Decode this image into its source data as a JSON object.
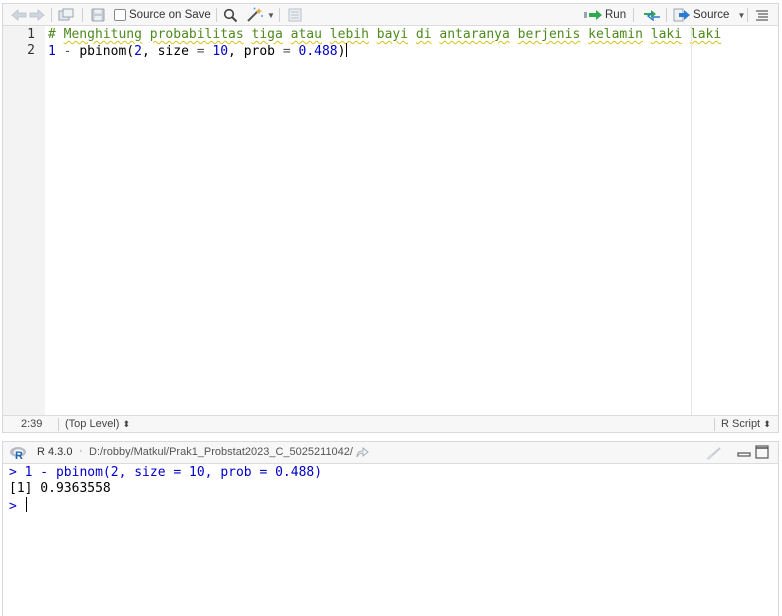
{
  "editor": {
    "toolbar": {
      "source_on_save_label": "Source on Save",
      "source_on_save_checked": false,
      "run_label": "Run",
      "source_label": "Source"
    },
    "lines": [
      {
        "number": "1",
        "text": "# Menghitung probabilitas tiga atau lebih bayi di antaranya berjenis kelamin laki laki"
      },
      {
        "number": "2",
        "text": "1 - pbinom(2, size = 10, prob = 0.488)"
      }
    ],
    "status": {
      "cursor_position": "2:39",
      "scope": "(Top Level)",
      "file_type": "R Script"
    }
  },
  "console": {
    "r_version": "R 4.3.0",
    "working_dir": "D:/robby/Matkul/Prak1_Probstat2023_C_5025211042/",
    "lines": [
      {
        "prompt": ">",
        "text": "1 - pbinom(2, size = 10, prob = 0.488)"
      },
      {
        "text": "[1] 0.9363558"
      },
      {
        "prompt": ">",
        "text": ""
      }
    ]
  },
  "colors": {
    "comment": "#4d8a1c",
    "number": "#0000c8",
    "console_input": "#0000c8",
    "run_arrow": "#2fa84f"
  },
  "icons": [
    "back-arrow-icon",
    "forward-arrow-icon",
    "show-in-window-icon",
    "save-icon",
    "search-icon",
    "code-tools-wand-icon",
    "compile-report-icon",
    "run-arrow-icon",
    "rerun-icon",
    "source-icon",
    "outline-icon",
    "r-logo-icon",
    "goto-dir-icon",
    "clear-console-icon",
    "minimize-icon",
    "maximize-icon"
  ]
}
